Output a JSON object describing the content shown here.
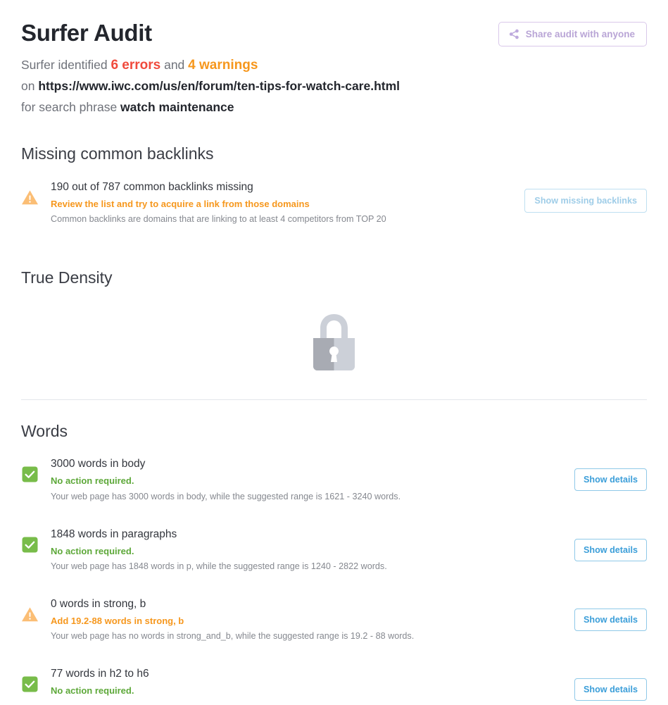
{
  "header": {
    "title": "Surfer Audit",
    "identified_prefix": "Surfer identified ",
    "errors": "6 errors",
    "and": " and ",
    "warnings": "4 warnings",
    "on_prefix": "on ",
    "url": "https://www.iwc.com/us/en/forum/ten-tips-for-watch-care.html",
    "phrase_prefix": "for search phrase ",
    "phrase": "watch maintenance",
    "share_label": "Share audit with anyone",
    "share_icon": "share-icon"
  },
  "colors": {
    "error": "#f04a3c",
    "warning": "#f6971d",
    "ok": "#5da839",
    "link": "#3b9ed9",
    "share": "#b9a5d6",
    "lock_dark": "#a8abb3",
    "lock_light": "#ccd0d8"
  },
  "backlinks": {
    "heading": "Missing common backlinks",
    "row": {
      "status": "warning",
      "icon": "warning-triangle-icon",
      "title": "190 out of 787 common backlinks missing",
      "action": "Review the list and try to acquire a link from those domains",
      "description": "Common backlinks are domains that are linking to at least 4 competitors from TOP 20",
      "button": "Show missing backlinks"
    }
  },
  "true_density": {
    "heading": "True Density",
    "locked": true,
    "icon": "lock-icon"
  },
  "words": {
    "heading": "Words",
    "rows": [
      {
        "status": "ok",
        "icon": "check-square-icon",
        "title": "3000 words in body",
        "action": "No action required.",
        "description": "Your web page has 3000 words in body, while the suggested range is 1621 - 3240 words.",
        "button": "Show details"
      },
      {
        "status": "ok",
        "icon": "check-square-icon",
        "title": "1848 words in paragraphs",
        "action": "No action required.",
        "description": "Your web page has 1848 words in p, while the suggested range is 1240 - 2822 words.",
        "button": "Show details"
      },
      {
        "status": "warning",
        "icon": "warning-triangle-icon",
        "title": "0 words in strong, b",
        "action": "Add 19.2-88 words in strong, b",
        "description": "Your web page has no words in strong_and_b, while the suggested range is 19.2 - 88 words.",
        "button": "Show details"
      },
      {
        "status": "ok",
        "icon": "check-square-icon",
        "title": "77 words in h2 to h6",
        "action": "No action required.",
        "description": "",
        "button": "Show details"
      }
    ]
  }
}
